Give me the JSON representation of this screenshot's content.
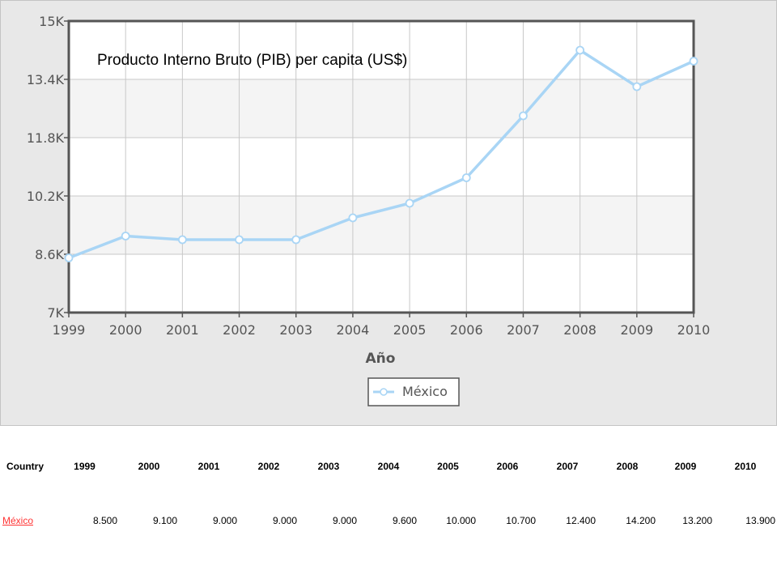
{
  "chart_data": {
    "type": "line",
    "title": "Producto Interno Bruto (PIB) per capita (US$)",
    "xlabel": "Año",
    "ylabel": "",
    "categories": [
      "1999",
      "2000",
      "2001",
      "2002",
      "2003",
      "2004",
      "2005",
      "2006",
      "2007",
      "2008",
      "2009",
      "2010"
    ],
    "series": [
      {
        "name": "México",
        "values": [
          8500,
          9100,
          9000,
          9000,
          9000,
          9600,
          10000,
          10700,
          12400,
          14200,
          13200,
          13900
        ]
      }
    ],
    "ylim": [
      7000,
      15000
    ],
    "yticks": [
      7000,
      8600,
      10200,
      11800,
      13400,
      15000
    ],
    "ytick_labels": [
      "7K",
      "8.6K",
      "10.2K",
      "11.8K",
      "13.4K",
      "15K"
    ],
    "grid": true,
    "legend": "bottom-center",
    "colors": {
      "series": "#a9d5f5",
      "panel": "#e8e8e8",
      "plot_band": "#f4f4f4"
    }
  },
  "table": {
    "headers": [
      "Country",
      "1999",
      "2000",
      "2001",
      "2002",
      "2003",
      "2004",
      "2005",
      "2006",
      "2007",
      "2008",
      "2009",
      "2010"
    ],
    "rows": [
      {
        "country": "México",
        "values": [
          "8.500",
          "9.100",
          "9.000",
          "9.000",
          "9.000",
          "9.600",
          "10.000",
          "10.700",
          "12.400",
          "14.200",
          "13.200",
          "13.900"
        ]
      }
    ]
  }
}
